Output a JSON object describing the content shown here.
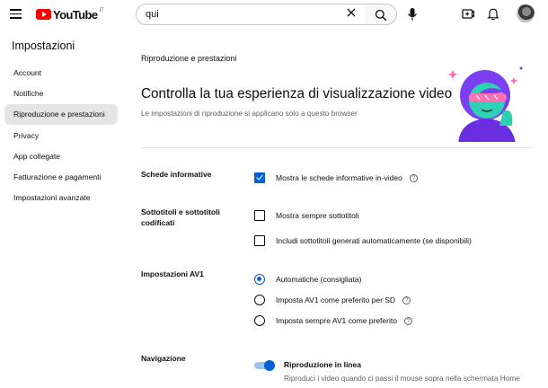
{
  "app": {
    "logo_text": "YouTube",
    "region": "IT",
    "brand_color": "#ff0000"
  },
  "search": {
    "value": "qui"
  },
  "icons": [
    "menu-icon",
    "clear-icon",
    "search-icon",
    "mic-icon",
    "create-icon",
    "bell-icon"
  ],
  "sidebar": {
    "title": "Impostazioni",
    "items": [
      {
        "label": "Account"
      },
      {
        "label": "Notifiche"
      },
      {
        "label": "Riproduzione e prestazioni",
        "active": true
      },
      {
        "label": "Privacy"
      },
      {
        "label": "App collegate"
      },
      {
        "label": "Fatturazione e pagamenti"
      },
      {
        "label": "Impostazioni avanzate"
      }
    ]
  },
  "main": {
    "section_label": "Riproduzione e prestazioni",
    "headline": "Controlla la tua esperienza di visualizzazione video",
    "subline": "Le impostazioni di riproduzione si applicano solo a questo browser",
    "cards": {
      "title": "Schede informative",
      "option": "Mostra le schede informative in-video",
      "checked": true
    },
    "subtitles": {
      "title": "Sottotitoli e sottotitoli codificati",
      "options": [
        {
          "label": "Mostra sempre sottotitoli",
          "checked": false
        },
        {
          "label": "Includi sottotitoli generati automaticamente (se disponibili)",
          "checked": false
        }
      ]
    },
    "av1": {
      "title": "Impostazioni AV1",
      "options": [
        {
          "label": "Automatiche (consigliata)",
          "selected": true
        },
        {
          "label": "Imposta AV1 come preferito per SD",
          "selected": false
        },
        {
          "label": "Imposta sempre AV1 come preferito",
          "selected": false
        }
      ]
    },
    "navigation": {
      "title": "Navigazione",
      "toggle_title": "Riproduzione in linea",
      "toggle_desc": "Riproduci i video quando ci passi il mouse sopra nella schermata Home",
      "enabled": true
    }
  },
  "colors": {
    "accent": "#065fd4",
    "text": "#0f0f0f",
    "secondary": "#606060"
  }
}
